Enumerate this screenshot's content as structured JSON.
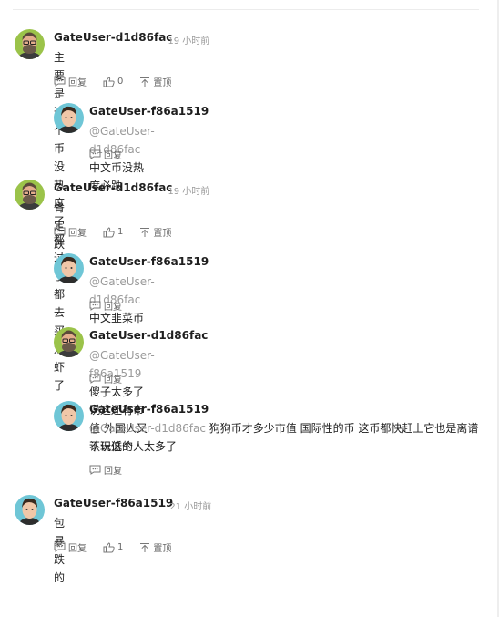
{
  "labels": {
    "reply": "回复",
    "pin": "置顶"
  },
  "comments": [
    {
      "user": "GateUser-d1d86fac",
      "time": "· 19 小时前",
      "text": "主要是这个币没热度了 都过了都去买龙虾了",
      "likes": "0",
      "replies": [
        {
          "user": "GateUser-f86a1519",
          "mention": "@GateUser-d1d86fac",
          "text": "中文币没热度必跌"
        }
      ]
    },
    {
      "user": "GateUser-d1d86fac",
      "time": "· 19 小时前",
      "text": "肯定跌",
      "likes": "1",
      "replies": [
        {
          "user": "GateUser-f86a1519",
          "mention": "@GateUser-d1d86fac",
          "text": "中文韭菜币"
        },
        {
          "user": "GateUser-d1d86fac",
          "mention": "@GateUser-f86a1519",
          "text": "傻子太多了 说这还有市值 外国人又不玩这个"
        },
        {
          "user": "GateUser-f86a1519",
          "mention": "@GateUser-d1d86fac",
          "text": "狗狗币才多少市值 国际性的币 这币都快赶上它也是离谱 认识低的人太多了"
        }
      ]
    },
    {
      "user": "GateUser-f86a1519",
      "time": "· 21 小时前",
      "text": "包暴跌的",
      "likes": "1",
      "replies": []
    }
  ],
  "icons": [
    "reply-icon",
    "like-icon",
    "pin-icon"
  ],
  "colors": {
    "muted": "#9a9a9a",
    "text": "#1f1f1f"
  }
}
